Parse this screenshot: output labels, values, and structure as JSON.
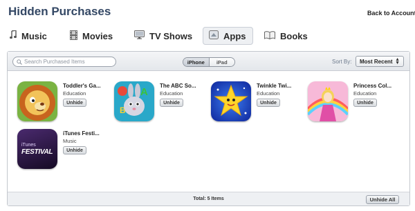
{
  "header": {
    "title": "Hidden Purchases",
    "back_link": "Back to Account"
  },
  "tabs": [
    {
      "label": "Music",
      "icon": "music-note-icon"
    },
    {
      "label": "Movies",
      "icon": "film-icon"
    },
    {
      "label": "TV Shows",
      "icon": "tv-icon"
    },
    {
      "label": "Apps",
      "icon": "app-icon",
      "active": true
    },
    {
      "label": "Books",
      "icon": "book-icon"
    }
  ],
  "toolbar": {
    "search_placeholder": "Search Purchased Items",
    "device_segments": [
      "iPhone",
      "iPad"
    ],
    "selected_device": "iPhone",
    "sort_label": "Sort By:",
    "sort_value": "Most Recent"
  },
  "items": [
    {
      "name": "Toddler's Ga...",
      "category": "Education",
      "button": "Unhide",
      "icon": "lion-app-icon"
    },
    {
      "name": "The ABC So...",
      "category": "Education",
      "button": "Unhide",
      "icon": "bunny-abc-app-icon"
    },
    {
      "name": "Twinkle Twi...",
      "category": "Education",
      "button": "Unhide",
      "icon": "star-app-icon"
    },
    {
      "name": "Princess Col...",
      "category": "Education",
      "button": "Unhide",
      "icon": "princess-app-icon"
    },
    {
      "name": "iTunes Festi...",
      "category": "Music",
      "button": "Unhide",
      "icon": "itunes-festival-app-icon",
      "icon_text_top": "iTunes",
      "icon_text_main": "FESTIVAL"
    }
  ],
  "footer": {
    "total": "Total: 5 Items",
    "unhide_all": "Unhide All"
  },
  "colors": {
    "title": "#344865",
    "accent": "#6c7a8c"
  }
}
